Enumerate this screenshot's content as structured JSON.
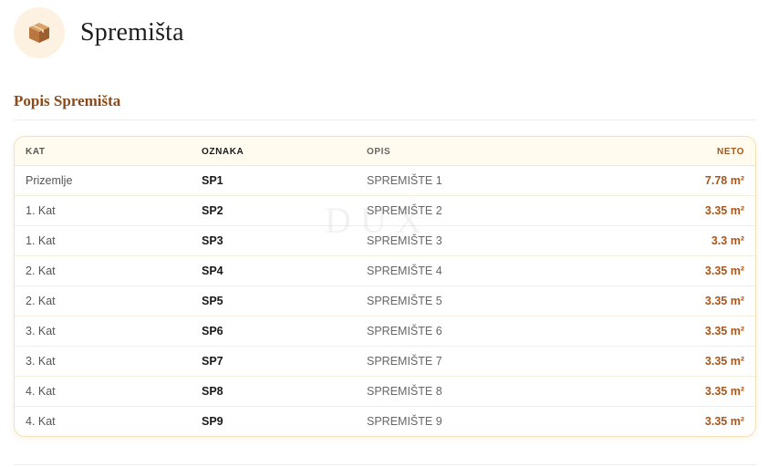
{
  "header": {
    "title": "Spremišta",
    "icon": "box-icon"
  },
  "section": {
    "title": "Popis Spremišta"
  },
  "table": {
    "columns": [
      "KAT",
      "OZNAKA",
      "OPIS",
      "NETO"
    ],
    "rows": [
      {
        "kat": "Prizemlje",
        "oznaka": "SP1",
        "opis": "SPREMIŠTE 1",
        "neto": "7.78 m²"
      },
      {
        "kat": "1. Kat",
        "oznaka": "SP2",
        "opis": "SPREMIŠTE 2",
        "neto": "3.35 m²"
      },
      {
        "kat": "1. Kat",
        "oznaka": "SP3",
        "opis": "SPREMIŠTE 3",
        "neto": "3.3 m²"
      },
      {
        "kat": "2. Kat",
        "oznaka": "SP4",
        "opis": "SPREMIŠTE 4",
        "neto": "3.35 m²"
      },
      {
        "kat": "2. Kat",
        "oznaka": "SP5",
        "opis": "SPREMIŠTE 5",
        "neto": "3.35 m²"
      },
      {
        "kat": "3. Kat",
        "oznaka": "SP6",
        "opis": "SPREMIŠTE 6",
        "neto": "3.35 m²"
      },
      {
        "kat": "3. Kat",
        "oznaka": "SP7",
        "opis": "SPREMIŠTE 7",
        "neto": "3.35 m²"
      },
      {
        "kat": "4. Kat",
        "oznaka": "SP8",
        "opis": "SPREMIŠTE 8",
        "neto": "3.35 m²"
      },
      {
        "kat": "4. Kat",
        "oznaka": "SP9",
        "opis": "SPREMIŠTE 9",
        "neto": "3.35 m²"
      }
    ]
  },
  "watermark": "DUX",
  "colors": {
    "accent": "#a8561c",
    "header_label": "#c98a14",
    "section_title": "#8a4a1a",
    "badge_bg": "#fdf1e2"
  }
}
